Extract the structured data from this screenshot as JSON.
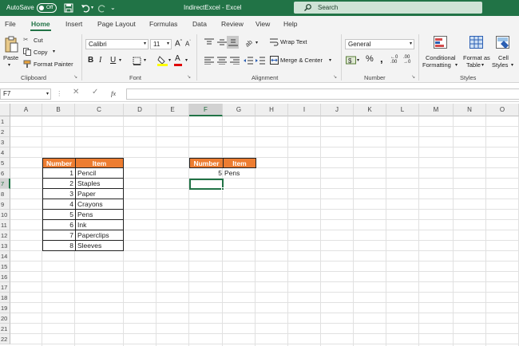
{
  "title_bar": {
    "autosave_label": "AutoSave",
    "autosave_state": "Off",
    "title": "IndirectExcel  -  Excel",
    "search_placeholder": "Search"
  },
  "menu_tabs": [
    "File",
    "Home",
    "Insert",
    "Page Layout",
    "Formulas",
    "Data",
    "Review",
    "View",
    "Help"
  ],
  "active_tab": "Home",
  "ribbon": {
    "clipboard": {
      "paste": "Paste",
      "cut": "Cut",
      "copy": "Copy",
      "format_painter": "Format Painter",
      "label": "Clipboard"
    },
    "font": {
      "name": "Calibri",
      "size": "11",
      "label": "Font"
    },
    "alignment": {
      "wrap_text": "Wrap Text",
      "merge_center": "Merge & Center",
      "label": "Alignment"
    },
    "number": {
      "format": "General",
      "label": "Number"
    },
    "styles": {
      "conditional_line1": "Conditional",
      "conditional_line2": "Formatting",
      "format_as_line1": "Format as",
      "format_as_line2": "Table",
      "cell_line1": "Cell",
      "cell_line2": "Styles",
      "label": "Styles"
    }
  },
  "name_box": "F7",
  "columns": [
    "A",
    "B",
    "C",
    "D",
    "E",
    "F",
    "G",
    "H",
    "I",
    "J",
    "K",
    "L",
    "M",
    "N",
    "O"
  ],
  "selected_column": "F",
  "rows": [
    "1",
    "2",
    "3",
    "4",
    "5",
    "6",
    "7",
    "8",
    "9",
    "10",
    "11",
    "12",
    "13",
    "14",
    "15",
    "16",
    "17",
    "18",
    "19",
    "20",
    "21",
    "22"
  ],
  "selected_row": "7",
  "table1": {
    "header": {
      "number": "Number",
      "item": "Item"
    },
    "rows": [
      {
        "number": "1",
        "item": "Pencil"
      },
      {
        "number": "2",
        "item": "Staples"
      },
      {
        "number": "3",
        "item": "Paper"
      },
      {
        "number": "4",
        "item": "Crayons"
      },
      {
        "number": "5",
        "item": "Pens"
      },
      {
        "number": "6",
        "item": "Ink"
      },
      {
        "number": "7",
        "item": "Paperclips"
      },
      {
        "number": "8",
        "item": "Sleeves"
      }
    ]
  },
  "table2": {
    "header": {
      "number": "Number",
      "item": "Item"
    },
    "number": "5",
    "item": "Pens"
  },
  "colors": {
    "excel_green": "#217346",
    "header_orange": "#ed7d31"
  }
}
